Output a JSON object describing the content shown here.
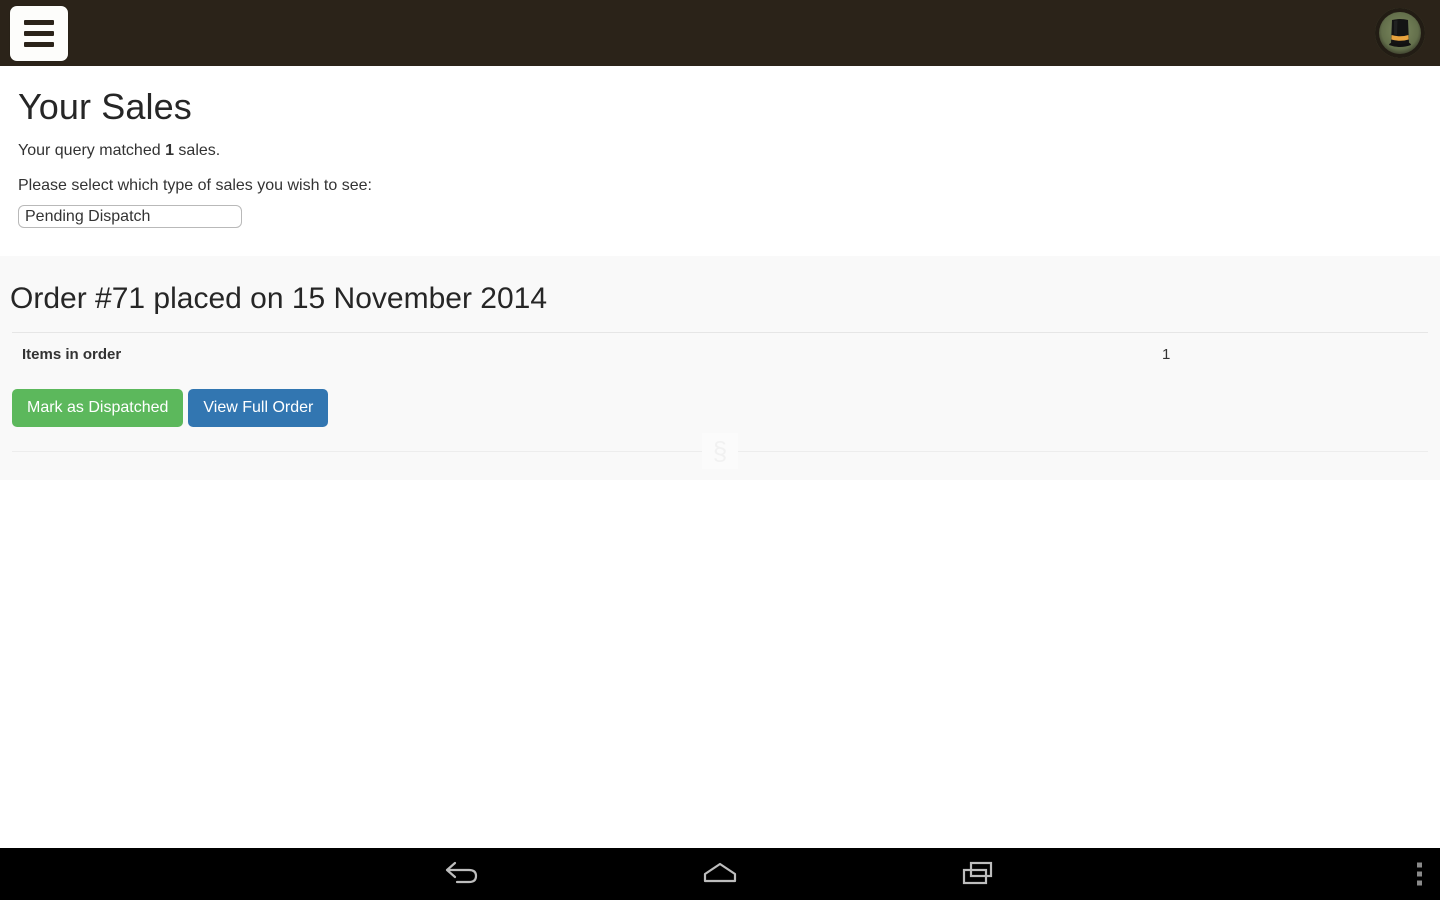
{
  "appbar": {
    "menu_icon": "hamburger-menu-icon",
    "avatar_icon": "top-hat-avatar",
    "background_color": "#2b2319",
    "avatar_background_color": "#6d7a52",
    "hat_band_color": "#e8a33d"
  },
  "page": {
    "title": "Your Sales",
    "query_prefix": "Your query matched",
    "query_count": "1",
    "query_suffix": "sales.",
    "select_label": "Please select which type of sales you wish to see:",
    "select_value": "Pending Dispatch",
    "select_options": [
      "Pending Dispatch"
    ]
  },
  "order": {
    "heading": "Order #71 placed on 15 November 2014",
    "row_label": "Items in order",
    "row_value": "1",
    "dispatch_button": "Mark as Dispatched",
    "view_button": "View Full Order",
    "dispatch_color": "#5cb85c",
    "view_color": "#3276b1",
    "watermark": "§"
  },
  "navbar": {
    "back_icon": "back-arrow-icon",
    "home_icon": "home-icon",
    "recents_icon": "recent-apps-icon",
    "overflow_icon": "overflow-menu-icon",
    "background_color": "#000000"
  }
}
